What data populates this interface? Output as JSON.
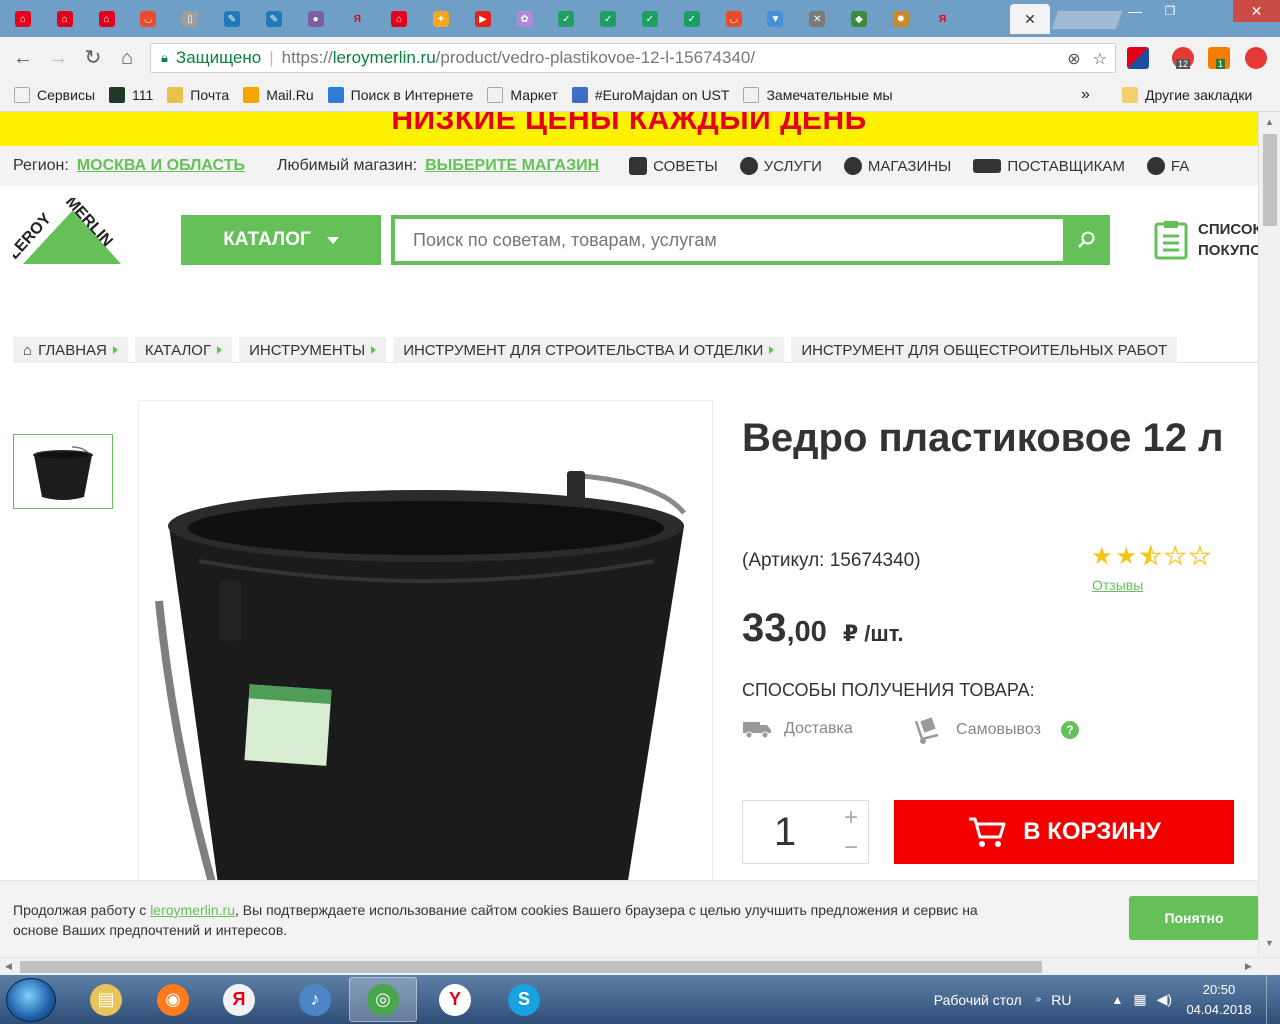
{
  "browser": {
    "tabs": [
      {
        "icon": "lm-icon",
        "color": "#e3001b",
        "glyph": "⌂"
      },
      {
        "icon": "lm-icon",
        "color": "#e3001b",
        "glyph": "⌂"
      },
      {
        "icon": "lm-icon",
        "color": "#e3001b",
        "glyph": "⌂"
      },
      {
        "icon": "aliexpress-icon",
        "color": "#e94b2c",
        "glyph": "◡"
      },
      {
        "icon": "document-icon",
        "color": "#9e9e9e",
        "glyph": "▯"
      },
      {
        "icon": "wrench-icon",
        "color": "#1e7bb8",
        "glyph": "✎"
      },
      {
        "icon": "wrench-icon",
        "color": "#1e7bb8",
        "glyph": "✎"
      },
      {
        "icon": "person-icon",
        "color": "#7a5ea8",
        "glyph": "●"
      },
      {
        "icon": "yandex-icon",
        "color": "#ffffff",
        "glyph": "Я"
      },
      {
        "icon": "lm-icon",
        "color": "#e3001b",
        "glyph": "⌂"
      },
      {
        "icon": "game-icon",
        "color": "#f5a623",
        "glyph": "✦"
      },
      {
        "icon": "youtube-icon",
        "color": "#e62117",
        "glyph": "▶"
      },
      {
        "icon": "dots-icon",
        "color": "#b089d8",
        "glyph": "✿"
      },
      {
        "icon": "bird-icon",
        "color": "#1e9e65",
        "glyph": "✓"
      },
      {
        "icon": "bird-icon",
        "color": "#1e9e65",
        "glyph": "✓"
      },
      {
        "icon": "bird-icon",
        "color": "#1e9e65",
        "glyph": "✓"
      },
      {
        "icon": "bird-icon",
        "color": "#1e9e65",
        "glyph": "✓"
      },
      {
        "icon": "aliexpress-icon",
        "color": "#e94b2c",
        "glyph": "◡"
      },
      {
        "icon": "triangle-icon",
        "color": "#4a8ed8",
        "glyph": "▼"
      },
      {
        "icon": "tools-icon",
        "color": "#7a7a7a",
        "glyph": "✕"
      },
      {
        "icon": "tag-icon",
        "color": "#3d8b3d",
        "glyph": "◆"
      },
      {
        "icon": "gear-icon",
        "color": "#c98a2a",
        "glyph": "✹"
      },
      {
        "icon": "yandex-icon",
        "color": "#ffffff",
        "glyph": "Я"
      }
    ],
    "active_tab_close": "✕",
    "secure_label": "Защищено",
    "url_scheme": "https://",
    "url_host": "leroymerlin.ru",
    "url_path": "/product/vedro-plastikovoe-12-l-15674340/",
    "ext_badge_1": "12",
    "ext_badge_2": "1",
    "bookmarks": [
      {
        "label": "Сервисы",
        "icon": "apps-icon",
        "color": "#ffffff"
      },
      {
        "label": "111",
        "icon": "f-icon",
        "color": "#1a3b2a"
      },
      {
        "label": "Почта",
        "icon": "mail-icon",
        "color": "#e8c14a"
      },
      {
        "label": "Mail.Ru",
        "icon": "at-icon",
        "color": "#f7a400"
      },
      {
        "label": "Поиск в Интернете",
        "icon": "search-icon",
        "color": "#2d7bd6"
      },
      {
        "label": "Маркет",
        "icon": "cart-icon",
        "color": "#ffffff"
      },
      {
        "label": "#EuroMajdan on UST",
        "icon": "u-icon",
        "color": "#3f6cc4"
      },
      {
        "label": "Замечательные мы",
        "icon": "person-icon",
        "color": "#ffffff"
      }
    ],
    "bookmarks_more": "»",
    "other_bookmarks": "Другие закладки"
  },
  "site": {
    "promo": "НИЗКИЕ ЦЕНЫ КАЖДЫЙ ДЕНЬ",
    "region_label": "Регион:",
    "region_value": "МОСКВА И ОБЛАСТЬ",
    "store_label": "Любимый магазин:",
    "store_value": "ВЫБЕРИТЕ МАГАЗИН",
    "menu": [
      {
        "label": "СОВЕТЫ",
        "icon": "chat-icon"
      },
      {
        "label": "УСЛУГИ",
        "icon": "gear-icon"
      },
      {
        "label": "МАГАЗИНЫ",
        "icon": "pin-icon"
      },
      {
        "label": "ПОСТАВЩИКАМ",
        "icon": "handshake-icon"
      },
      {
        "label": "FA",
        "icon": "question-icon"
      }
    ],
    "logo_top": "LEROY",
    "logo_bottom": "MERLIN",
    "catalog_label": "КАТАЛОГ",
    "search_placeholder": "Поиск по советам, товарам, услугам",
    "shoplist_line1": "СПИСОК",
    "shoplist_line2": "ПОКУПО",
    "accent": "#66c05a"
  },
  "breadcrumbs": [
    "ГЛАВНАЯ",
    "КАТАЛОГ",
    "ИНСТРУМЕНТЫ",
    "ИНСТРУМЕНТ ДЛЯ СТРОИТЕЛЬСТВА И ОТДЕЛКИ",
    "ИНСТРУМЕНТ ДЛЯ ОБЩЕСТРОИТЕЛЬНЫХ РАБОТ"
  ],
  "product": {
    "title": "Ведро пластиковое 12 л",
    "article": "(Артикул: 15674340)",
    "rating": 2.5,
    "rating_max": 5,
    "reviews_label": "Отзывы",
    "price_int": "33",
    "price_dec": ",00",
    "price_unit": "₽ /шт.",
    "methods_title": "СПОСОБЫ ПОЛУЧЕНИЯ ТОВАРА:",
    "delivery_label": "Доставка",
    "pickup_label": "Самовывоз",
    "help_mark": "?",
    "quantity": "1",
    "qty_plus": "+",
    "qty_minus": "−",
    "cart_label": "В КОРЗИНУ"
  },
  "cookie": {
    "text_before": "Продолжая работу с ",
    "link": "leroymerlin.ru",
    "text_after": ", Вы подтверждаете использование сайтом cookies Вашего браузера с целью улучшить предложения и сервис на основе Ваших предпочтений и интересов.",
    "ok_label": "Понятно"
  },
  "taskbar": {
    "apps": [
      {
        "name": "explorer",
        "color": "#e8c25a",
        "glyph": "▤"
      },
      {
        "name": "firefox",
        "color": "#ff7b1c",
        "glyph": "◉"
      },
      {
        "name": "yandex-browser",
        "color": "#f2f2f2",
        "glyph": "Я"
      },
      {
        "name": "sound",
        "color": "#4d86c6",
        "glyph": "♪"
      },
      {
        "name": "chrome",
        "color": "#4aa64e",
        "glyph": "◎"
      },
      {
        "name": "yandex",
        "color": "#ffffff",
        "glyph": "Y"
      },
      {
        "name": "skype",
        "color": "#1aa1e0",
        "glyph": "S"
      }
    ],
    "desktop_label": "Рабочий стол",
    "lang": "RU",
    "time": "20:50",
    "date": "04.04.2018"
  }
}
